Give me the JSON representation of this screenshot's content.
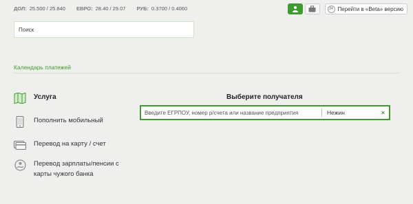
{
  "rates": {
    "usd": {
      "label": "ДОЛ:",
      "value": "25.500 / 25.840"
    },
    "eur": {
      "label": "ЕВРО:",
      "value": "28.40 / 29.07"
    },
    "rub": {
      "label": "РУБ:",
      "value": "0.3700 / 0.4060"
    }
  },
  "header": {
    "beta_badge": "24",
    "beta_label": "Перейти в «Beta» версию"
  },
  "search": {
    "placeholder": "Поиск"
  },
  "calendar_link": "Календарь платежей",
  "menu": {
    "items": [
      {
        "label": "Услуга",
        "icon": "map-icon"
      },
      {
        "label": "Пополнить мобильный",
        "icon": "mobile-phone-icon"
      },
      {
        "label": "Перевод на карту / счет",
        "icon": "card-icon"
      },
      {
        "label": "Перевод зарплаты/пенсии с карты чужого банка",
        "icon": "hand-coin-icon"
      }
    ]
  },
  "recipient": {
    "title": "Выберите получателя",
    "placeholder": "Введите ЕГРПОУ, номер р/счета или название предприятия",
    "city": "Нежин",
    "clear": "×"
  },
  "colors": {
    "accent": "#3f9a2f",
    "background": "#efefed",
    "text": "#333333"
  }
}
